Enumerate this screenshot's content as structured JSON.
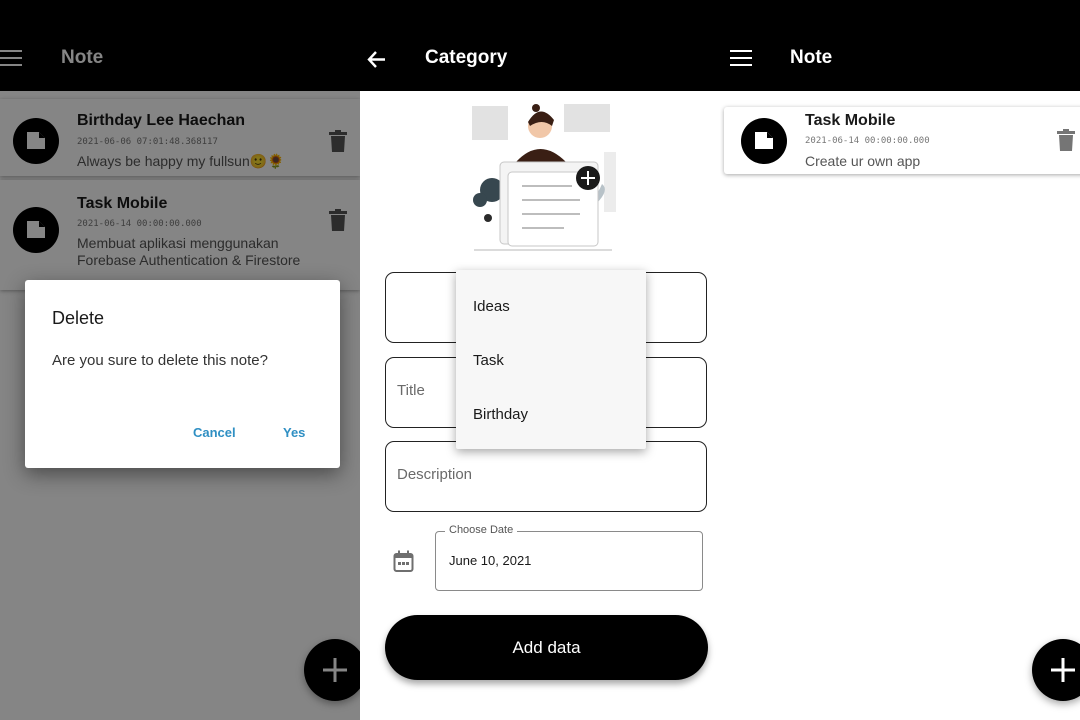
{
  "left_screen": {
    "appbar_title": "Note",
    "menu_icon": "hamburger-menu-icon",
    "notes": [
      {
        "title": "Birthday Lee Haechan",
        "date": "2021-06-06 07:01:48.368117",
        "description": "Always be happy my fullsun🙂🌻",
        "icon": "note-icon"
      },
      {
        "title": "Task Mobile",
        "date": "2021-06-14 00:00:00.000",
        "description": "Membuat aplikasi menggunakan Forebase Authentication & Firestore",
        "icon": "note-icon"
      }
    ],
    "dialog": {
      "title": "Delete",
      "message": "Are you sure to delete this note?",
      "cancel_label": "Cancel",
      "confirm_label": "Yes"
    },
    "fab_icon": "plus-icon"
  },
  "middle_screen": {
    "appbar_title": "Category",
    "back_icon": "arrow-back-icon",
    "category_options": [
      "Ideas",
      "Task",
      "Birthday"
    ],
    "title_placeholder": "Title",
    "description_placeholder": "Description",
    "date_field_label": "Choose Date",
    "date_value": "June 10, 2021",
    "calendar_icon": "calendar-icon",
    "add_button_label": "Add data"
  },
  "right_screen": {
    "appbar_title": "Note",
    "notes": [
      {
        "title": "Task Mobile",
        "date": "2021-06-14 00:00:00.000",
        "description": "Create ur own app",
        "icon": "note-icon"
      }
    ],
    "fab_icon": "plus-icon"
  },
  "colors": {
    "appbar": "#000000",
    "dialog_button": "#2f8fc3",
    "scrim": "rgba(0,0,0,0.48)"
  }
}
